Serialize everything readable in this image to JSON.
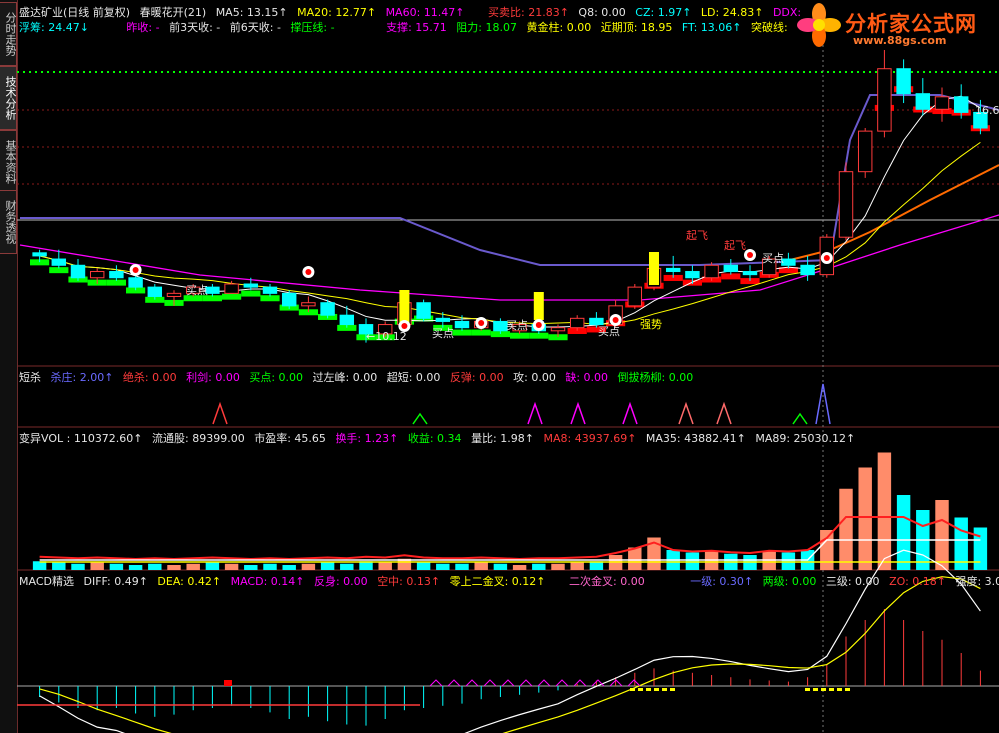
{
  "sidebar": {
    "tabs": [
      {
        "label": "分时走势",
        "active": false
      },
      {
        "label": "技术分析",
        "active": true
      },
      {
        "label": "基本资料",
        "active": false
      },
      {
        "label": "财务透视",
        "active": false
      }
    ]
  },
  "logo": {
    "title": "分析家公式网",
    "url": "www.88gs.com"
  },
  "main": {
    "header1": {
      "title": "盛达矿业(日线 前复权)",
      "indicator": "春暖花开(21)",
      "ma5": "MA5: 13.15↑",
      "ma20": "MA20: 12.77↑",
      "ma60": "MA60: 11.47↑",
      "buysell": "买卖比: 21.83↑",
      "q8": "Q8: 0.00",
      "cz": "CZ: 1.97↑",
      "ld": "LD: 24.83↑",
      "ddx": "DDX:"
    },
    "header2": {
      "fuchou": "浮筹: 24.47↓",
      "zuoshou": "昨收: -",
      "qian3": "前3天收: -",
      "qian6": "前6天收: -",
      "yaxian": "撑压线: -",
      "zhicheng": "支撑: 15.71",
      "zuli": "阻力: 18.07",
      "huangjin": "黄金柱: 0.00",
      "jinqiding": "近期顶: 18.95",
      "ft": "FT: 13.06↑",
      "tupo": "突破线:"
    },
    "annotations": {
      "buy": "买点",
      "low_price": "←10.12",
      "chao": "起飞",
      "right_price": "16.6",
      "gu": "强势"
    }
  },
  "panel2": {
    "name": "短杀",
    "shazhuang": "杀庄: 2.00↑",
    "juesha": "绝杀: 0.00",
    "lijian": "利剑: 0.00",
    "maidian": "买点: 0.00",
    "guozuofeng": "过左峰: 0.00",
    "chaoduan": "超短: 0.00",
    "fanzhuan": "反弹: 0.00",
    "gong": "攻: 0.00",
    "que": "缺: 0.00",
    "daobayangliu": "倒拔杨柳: 0.00"
  },
  "panel3": {
    "vol": "变异VOL : 110372.60↑",
    "liutong": "流通股: 89399.00",
    "shiying": "市盈率: 45.65",
    "huanshou": "换手: 1.23↑",
    "shouyi": "收益: 0.34",
    "liangbi": "量比: 1.98↑",
    "ma8": "MA8: 43937.69↑",
    "ma35": "MA35: 43882.41↑",
    "ma89": "MA89: 25030.12↑"
  },
  "panel4": {
    "name": "MACD精选",
    "diff": "DIFF: 0.49↑",
    "dea": "DEA: 0.42↑",
    "macd": "MACD: 0.14↑",
    "fanshen": "反身: 0.00",
    "kongzhong": "空中: 0.13↑",
    "lingshang": "零上二金叉: 0.12↑",
    "erci": "二次金叉: 0.00",
    "yiji": "一级: 0.30↑",
    "liangji": "两级: 0.00",
    "sanji": "三级: 0.00",
    "zo": "ZO: 0.18↑",
    "qiangdu": "强度: 3.01↓"
  },
  "colors": {
    "up": "#ff3b3b",
    "down": "#00ffff",
    "ma5": "#ffffff",
    "ma20": "#ffff00",
    "ma60": "#ff00ff",
    "long": "#6a5acd",
    "support": "#ff6a00",
    "band_green": "#00ff00",
    "band_red": "#ff0000",
    "axis": "#7a2a2a"
  },
  "chart_data": [
    {
      "type": "candlestick",
      "title": "盛达矿业(日线 前复权)",
      "price_range": [
        9.5,
        19.5
      ],
      "candles": [
        [
          13.0,
          13.1,
          12.7,
          12.9
        ],
        [
          12.8,
          13.1,
          12.5,
          12.6
        ],
        [
          12.6,
          12.8,
          12.1,
          12.2
        ],
        [
          12.2,
          12.5,
          12.0,
          12.4
        ],
        [
          12.4,
          12.6,
          12.1,
          12.2
        ],
        [
          12.2,
          12.3,
          11.8,
          11.9
        ],
        [
          11.9,
          12.0,
          11.5,
          11.6
        ],
        [
          11.6,
          11.8,
          11.3,
          11.7
        ],
        [
          11.7,
          12.0,
          11.6,
          11.9
        ],
        [
          11.9,
          12.0,
          11.6,
          11.7
        ],
        [
          11.7,
          12.1,
          11.7,
          12.0
        ],
        [
          12.0,
          12.2,
          11.8,
          11.9
        ],
        [
          11.9,
          12.0,
          11.6,
          11.7
        ],
        [
          11.7,
          11.8,
          11.2,
          11.3
        ],
        [
          11.3,
          11.6,
          11.1,
          11.4
        ],
        [
          11.4,
          11.5,
          10.9,
          11.0
        ],
        [
          11.0,
          11.3,
          10.6,
          10.7
        ],
        [
          10.7,
          10.9,
          10.12,
          10.4
        ],
        [
          10.4,
          10.8,
          10.3,
          10.7
        ],
        [
          10.7,
          11.6,
          10.6,
          11.4
        ],
        [
          11.4,
          11.5,
          10.8,
          10.9
        ],
        [
          10.9,
          11.1,
          10.6,
          10.8
        ],
        [
          10.8,
          11.0,
          10.5,
          10.6
        ],
        [
          10.6,
          10.9,
          10.5,
          10.8
        ],
        [
          10.8,
          10.9,
          10.4,
          10.5
        ],
        [
          10.5,
          10.8,
          10.4,
          10.7
        ],
        [
          10.7,
          10.8,
          10.4,
          10.5
        ],
        [
          10.5,
          10.7,
          10.3,
          10.6
        ],
        [
          10.6,
          11.0,
          10.5,
          10.9
        ],
        [
          10.9,
          11.1,
          10.6,
          10.7
        ],
        [
          10.7,
          11.5,
          10.6,
          11.3
        ],
        [
          11.3,
          12.0,
          11.2,
          11.9
        ],
        [
          11.9,
          12.6,
          11.8,
          12.5
        ],
        [
          12.5,
          12.9,
          12.2,
          12.4
        ],
        [
          12.4,
          12.6,
          12.0,
          12.2
        ],
        [
          12.2,
          12.7,
          12.1,
          12.6
        ],
        [
          12.6,
          12.8,
          12.3,
          12.4
        ],
        [
          12.4,
          12.6,
          12.1,
          12.3
        ],
        [
          12.3,
          12.9,
          12.2,
          12.8
        ],
        [
          12.8,
          13.0,
          12.5,
          12.6
        ],
        [
          12.6,
          12.9,
          12.1,
          12.3
        ],
        [
          12.3,
          13.6,
          12.2,
          13.5
        ],
        [
          13.5,
          15.9,
          13.4,
          15.6
        ],
        [
          15.6,
          17.0,
          15.4,
          16.9
        ],
        [
          16.9,
          19.5,
          16.7,
          18.9
        ],
        [
          18.9,
          19.2,
          17.8,
          18.1
        ],
        [
          18.1,
          18.6,
          17.4,
          17.6
        ],
        [
          17.6,
          18.3,
          17.2,
          18.0
        ],
        [
          18.0,
          18.4,
          17.3,
          17.5
        ],
        [
          17.5,
          17.9,
          16.8,
          17.0
        ]
      ],
      "signals": [
        "买点",
        "买点",
        "买点",
        "买点",
        "买点",
        "买点",
        "买点",
        "买点",
        "起飞"
      ],
      "low_label": "←10.12"
    },
    {
      "type": "bar",
      "title": "变异VOL",
      "values": [
        0.7,
        0.6,
        0.5,
        0.6,
        0.5,
        0.4,
        0.5,
        0.4,
        0.5,
        0.6,
        0.5,
        0.4,
        0.5,
        0.4,
        0.5,
        0.6,
        0.5,
        0.7,
        0.6,
        0.9,
        0.6,
        0.5,
        0.5,
        0.6,
        0.5,
        0.4,
        0.5,
        0.5,
        0.6,
        0.7,
        1.2,
        1.8,
        2.6,
        1.6,
        1.4,
        1.5,
        1.3,
        1.2,
        1.5,
        1.4,
        1.6,
        3.2,
        6.5,
        8.2,
        9.4,
        6.0,
        4.8,
        5.6,
        4.2,
        3.4
      ]
    },
    {
      "type": "bar",
      "title": "MACD精选",
      "values": [
        -0.1,
        -0.15,
        -0.2,
        -0.22,
        -0.2,
        -0.25,
        -0.28,
        -0.26,
        -0.22,
        -0.2,
        -0.18,
        -0.2,
        -0.24,
        -0.3,
        -0.28,
        -0.32,
        -0.35,
        -0.36,
        -0.3,
        -0.22,
        -0.2,
        -0.18,
        -0.16,
        -0.12,
        -0.1,
        -0.08,
        -0.06,
        -0.04,
        0.02,
        0.05,
        0.08,
        0.12,
        0.16,
        0.14,
        0.12,
        0.1,
        0.08,
        0.06,
        0.05,
        0.04,
        0.08,
        0.2,
        0.45,
        0.6,
        0.7,
        0.6,
        0.5,
        0.42,
        0.3,
        0.14
      ]
    }
  ]
}
